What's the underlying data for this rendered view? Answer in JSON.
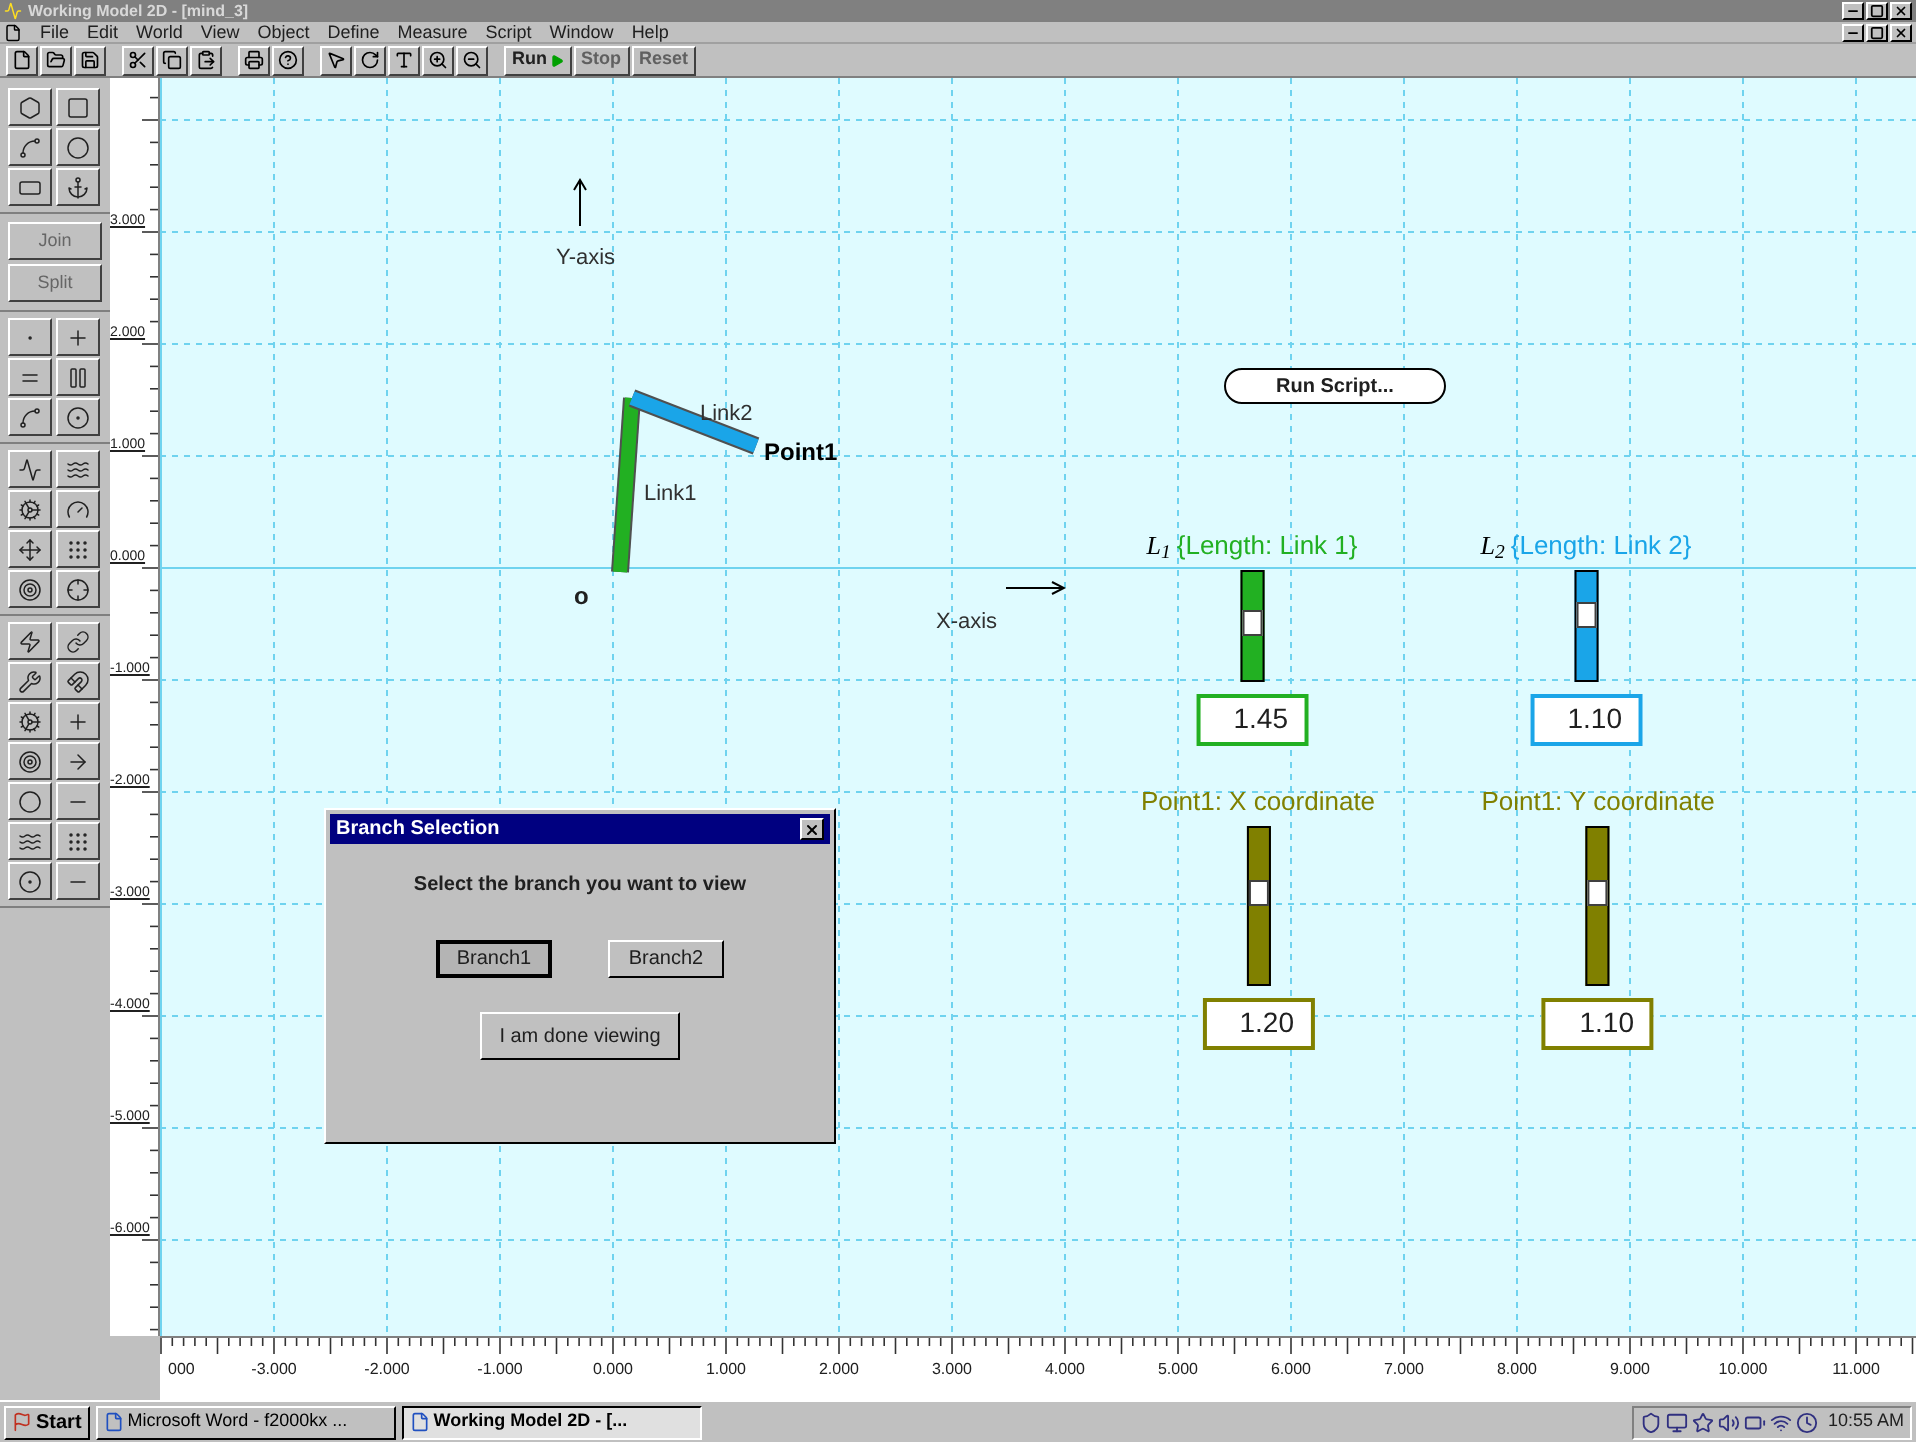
{
  "window": {
    "title": "Working Model 2D - [mind_3]"
  },
  "menu": [
    "File",
    "Edit",
    "World",
    "View",
    "Object",
    "Define",
    "Measure",
    "Script",
    "Window",
    "Help"
  ],
  "toolbar": {
    "buttons": [
      {
        "label": "Run",
        "disabled": false
      },
      {
        "label": "Stop",
        "disabled": true
      },
      {
        "label": "Reset",
        "disabled": true
      }
    ]
  },
  "palette": {
    "buttons": [
      {
        "label": "Join",
        "disabled": true
      },
      {
        "label": "Split",
        "disabled": true
      }
    ]
  },
  "rulers": {
    "x_labels": [
      "000",
      "-3.000",
      "-2.000",
      "-1.000",
      "0.000",
      "1.000",
      "2.000",
      "3.000",
      "4.000",
      "5.000",
      "6.000",
      "7.000",
      "8.000",
      "9.000",
      "10.000",
      "11.000"
    ],
    "y_labels": [
      "3.000",
      "2.000",
      "1.000",
      "0.000",
      "-1.000",
      "-2.000",
      "-3.000",
      "-4.000",
      "-5.000",
      "-6.000"
    ]
  },
  "canvas": {
    "y_axis_label": "Y-axis",
    "x_axis_label": "X-axis",
    "origin_label": "o",
    "point_label": "Point1",
    "links": [
      {
        "name": "Link1",
        "color": "#22b022"
      },
      {
        "name": "Link2",
        "color": "#1aa5e8"
      }
    ],
    "run_script_button": "Run Script...",
    "controls": [
      {
        "kind": "length",
        "symbol": "L$_{1}$",
        "label": "{Length: Link 1}",
        "color": "#22b022",
        "level": 0.55,
        "value": "1.45"
      },
      {
        "kind": "length",
        "symbol": "L$_{2}$",
        "label": "{Length: Link 2}",
        "color": "#1aa5e8",
        "level": 0.65,
        "value": "1.10"
      },
      {
        "kind": "coordinate",
        "label": "Point1: X coordinate",
        "color": "#808000",
        "level": 0.6,
        "value": "1.20"
      },
      {
        "kind": "coordinate",
        "label": "Point1: Y coordinate",
        "color": "#808000",
        "level": 0.6,
        "value": "1.10"
      }
    ]
  },
  "dialog": {
    "title": "Branch Selection",
    "prompt": "Select the branch you want to view",
    "buttons": [
      {
        "label": "Branch1",
        "selected": true
      },
      {
        "label": "Branch2",
        "selected": false
      }
    ],
    "done_button": "I am done viewing"
  },
  "taskbar": {
    "start": "Start",
    "tasks": [
      {
        "label": "Microsoft Word - f2000kx ...",
        "selected": false
      },
      {
        "label": "Working Model 2D - [...",
        "selected": true
      }
    ],
    "clock": "10:55 AM"
  }
}
